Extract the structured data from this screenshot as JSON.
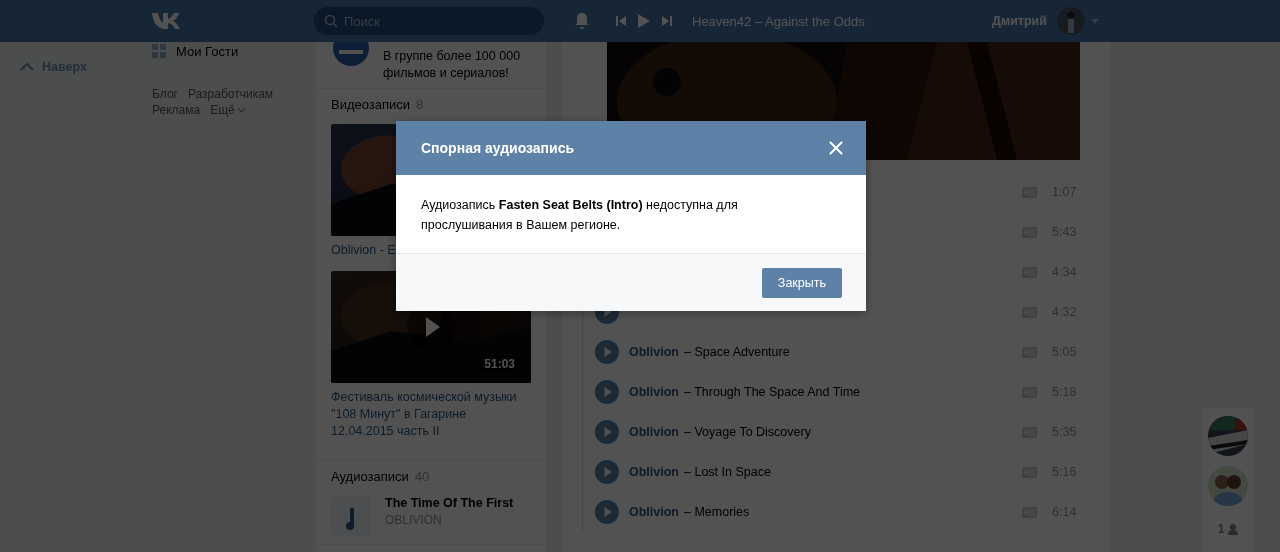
{
  "header": {
    "search": {
      "placeholder": "Поиск"
    },
    "now_playing": "Heaven42 – Against the Odds",
    "user_name": "Дмитрий"
  },
  "scroll_up": "Наверх",
  "left_menu": {
    "items": [
      {
        "label": "Мои Гости"
      }
    ],
    "footer_links": [
      {
        "label": "Блог"
      },
      {
        "label": "Разработчикам"
      },
      {
        "label": "Реклама"
      },
      {
        "label": "Ещё",
        "dropdown": true
      }
    ]
  },
  "group_snippet": {
    "description": "В группе более 100 000 фильмов и сериалов!"
  },
  "videos": {
    "title": "Видеозаписи",
    "count": "8",
    "items": [
      {
        "caption": "Oblivion - E"
      },
      {
        "caption": "Фестиваль космической музыки \"108 Минут\" в Гагарине 12.04.2015 часть II",
        "duration": "51:03"
      }
    ]
  },
  "audios": {
    "title": "Аудиозаписи",
    "count": "40",
    "items": [
      {
        "title": "The Time Of The First",
        "artist": "OBLIVION"
      }
    ]
  },
  "tracks": [
    {
      "kind": "covered",
      "duration": "1:07"
    },
    {
      "kind": "covered",
      "duration": "5:43"
    },
    {
      "kind": "covered",
      "duration": "4:34"
    },
    {
      "kind": "partial",
      "duration": "4:32"
    },
    {
      "artist": "Oblivion",
      "title": "– Space Adventure",
      "duration": "5:05"
    },
    {
      "artist": "Oblivion",
      "title": "– Through The Space And Time",
      "duration": "5:18"
    },
    {
      "artist": "Oblivion",
      "title": "– Voyage To Discovery",
      "duration": "5:35"
    },
    {
      "artist": "Oblivion",
      "title": "– Lost In Space",
      "duration": "5:16"
    },
    {
      "artist": "Oblivion",
      "title": "– Memories",
      "duration": "6:14"
    }
  ],
  "friends_panel": {
    "count": "1"
  },
  "modal": {
    "title": "Спорная аудиозапись",
    "message": "Аудиозапись **Fasten Seat Belts (Intro)** недоступна для прослушивания в Вашем регионе.",
    "button": "Закрыть"
  }
}
